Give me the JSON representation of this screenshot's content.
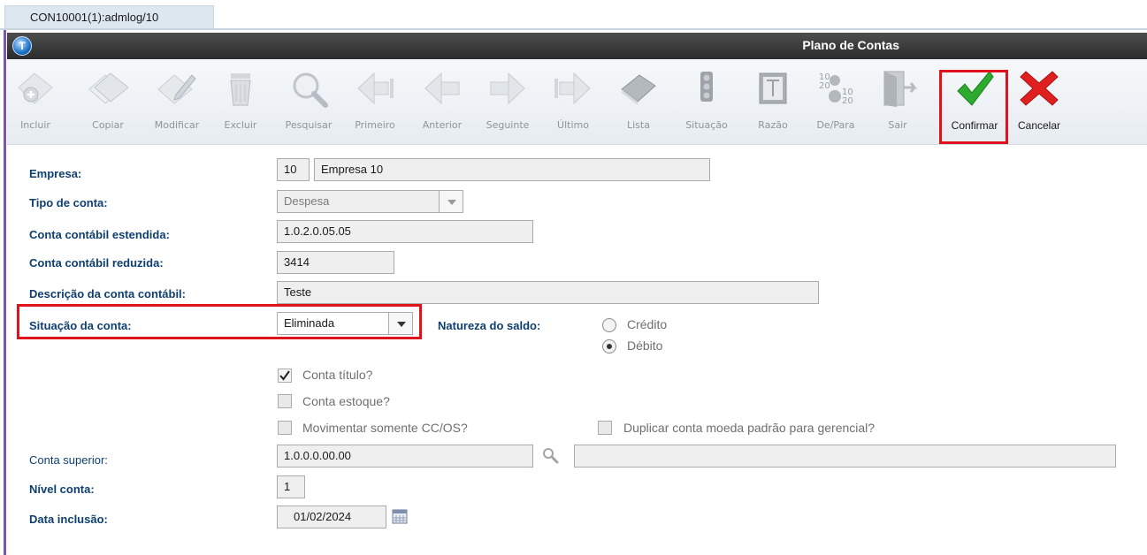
{
  "window_tab": "CON10001(1):admlog/10",
  "window_title": "Plano de Contas",
  "toolbar": {
    "items": [
      {
        "label": "Incluir",
        "icon": "add-document-icon"
      },
      {
        "label": "Copiar",
        "icon": "copy-icon"
      },
      {
        "label": "Modificar",
        "icon": "edit-icon"
      },
      {
        "label": "Excluir",
        "icon": "trash-icon"
      },
      {
        "label": "Pesquisar",
        "icon": "search-icon"
      },
      {
        "label": "Primeiro",
        "icon": "first-arrow-icon"
      },
      {
        "label": "Anterior",
        "icon": "previous-arrow-icon"
      },
      {
        "label": "Seguinte",
        "icon": "next-arrow-icon"
      },
      {
        "label": "Último",
        "icon": "last-arrow-icon"
      },
      {
        "label": "Lista",
        "icon": "book-list-icon"
      },
      {
        "label": "Situação",
        "icon": "traffic-light-icon"
      },
      {
        "label": "Razão",
        "icon": "ledger-icon"
      },
      {
        "label": "De/Para",
        "icon": "mapping-gears-icon"
      },
      {
        "label": "Sair",
        "icon": "exit-door-icon"
      },
      {
        "label": "Confirmar",
        "icon": "checkmark-icon"
      },
      {
        "label": "Cancelar",
        "icon": "red-x-icon"
      }
    ]
  },
  "form": {
    "empresa": {
      "label": "Empresa:",
      "code": "10",
      "name": "Empresa 10"
    },
    "tipo_conta": {
      "label": "Tipo de conta:",
      "value": "Despesa"
    },
    "conta_estendida": {
      "label": "Conta contábil estendida:",
      "value": "1.0.2.0.05.05"
    },
    "conta_reduzida": {
      "label": "Conta contábil reduzida:",
      "value": "3414"
    },
    "descricao": {
      "label": "Descrição da conta contábil:",
      "value": "Teste"
    },
    "situacao": {
      "label": "Situação da conta:",
      "value": "Eliminada"
    },
    "natureza": {
      "label": "Natureza do saldo:",
      "options": [
        "Crédito",
        "Débito"
      ],
      "selected": "Débito"
    },
    "checks": {
      "conta_titulo": {
        "label": "Conta título?",
        "checked": true
      },
      "conta_estoque": {
        "label": "Conta estoque?",
        "checked": false
      },
      "mov_cc": {
        "label": "Movimentar somente CC/OS?",
        "checked": false
      },
      "duplicar": {
        "label": "Duplicar conta moeda padrão para gerencial?",
        "checked": false
      }
    },
    "conta_superior": {
      "label": "Conta superior:",
      "value": "1.0.0.0.00.00",
      "description": ""
    },
    "nivel": {
      "label": "Nível conta:",
      "value": "1"
    },
    "data_inclusao": {
      "label": "Data inclusão:",
      "value": "01/02/2024"
    }
  },
  "colors": {
    "highlight": "#e0121b",
    "label": "#0f3f6f",
    "confirm_green": "#2eab2e",
    "cancel_red": "#e02020"
  }
}
